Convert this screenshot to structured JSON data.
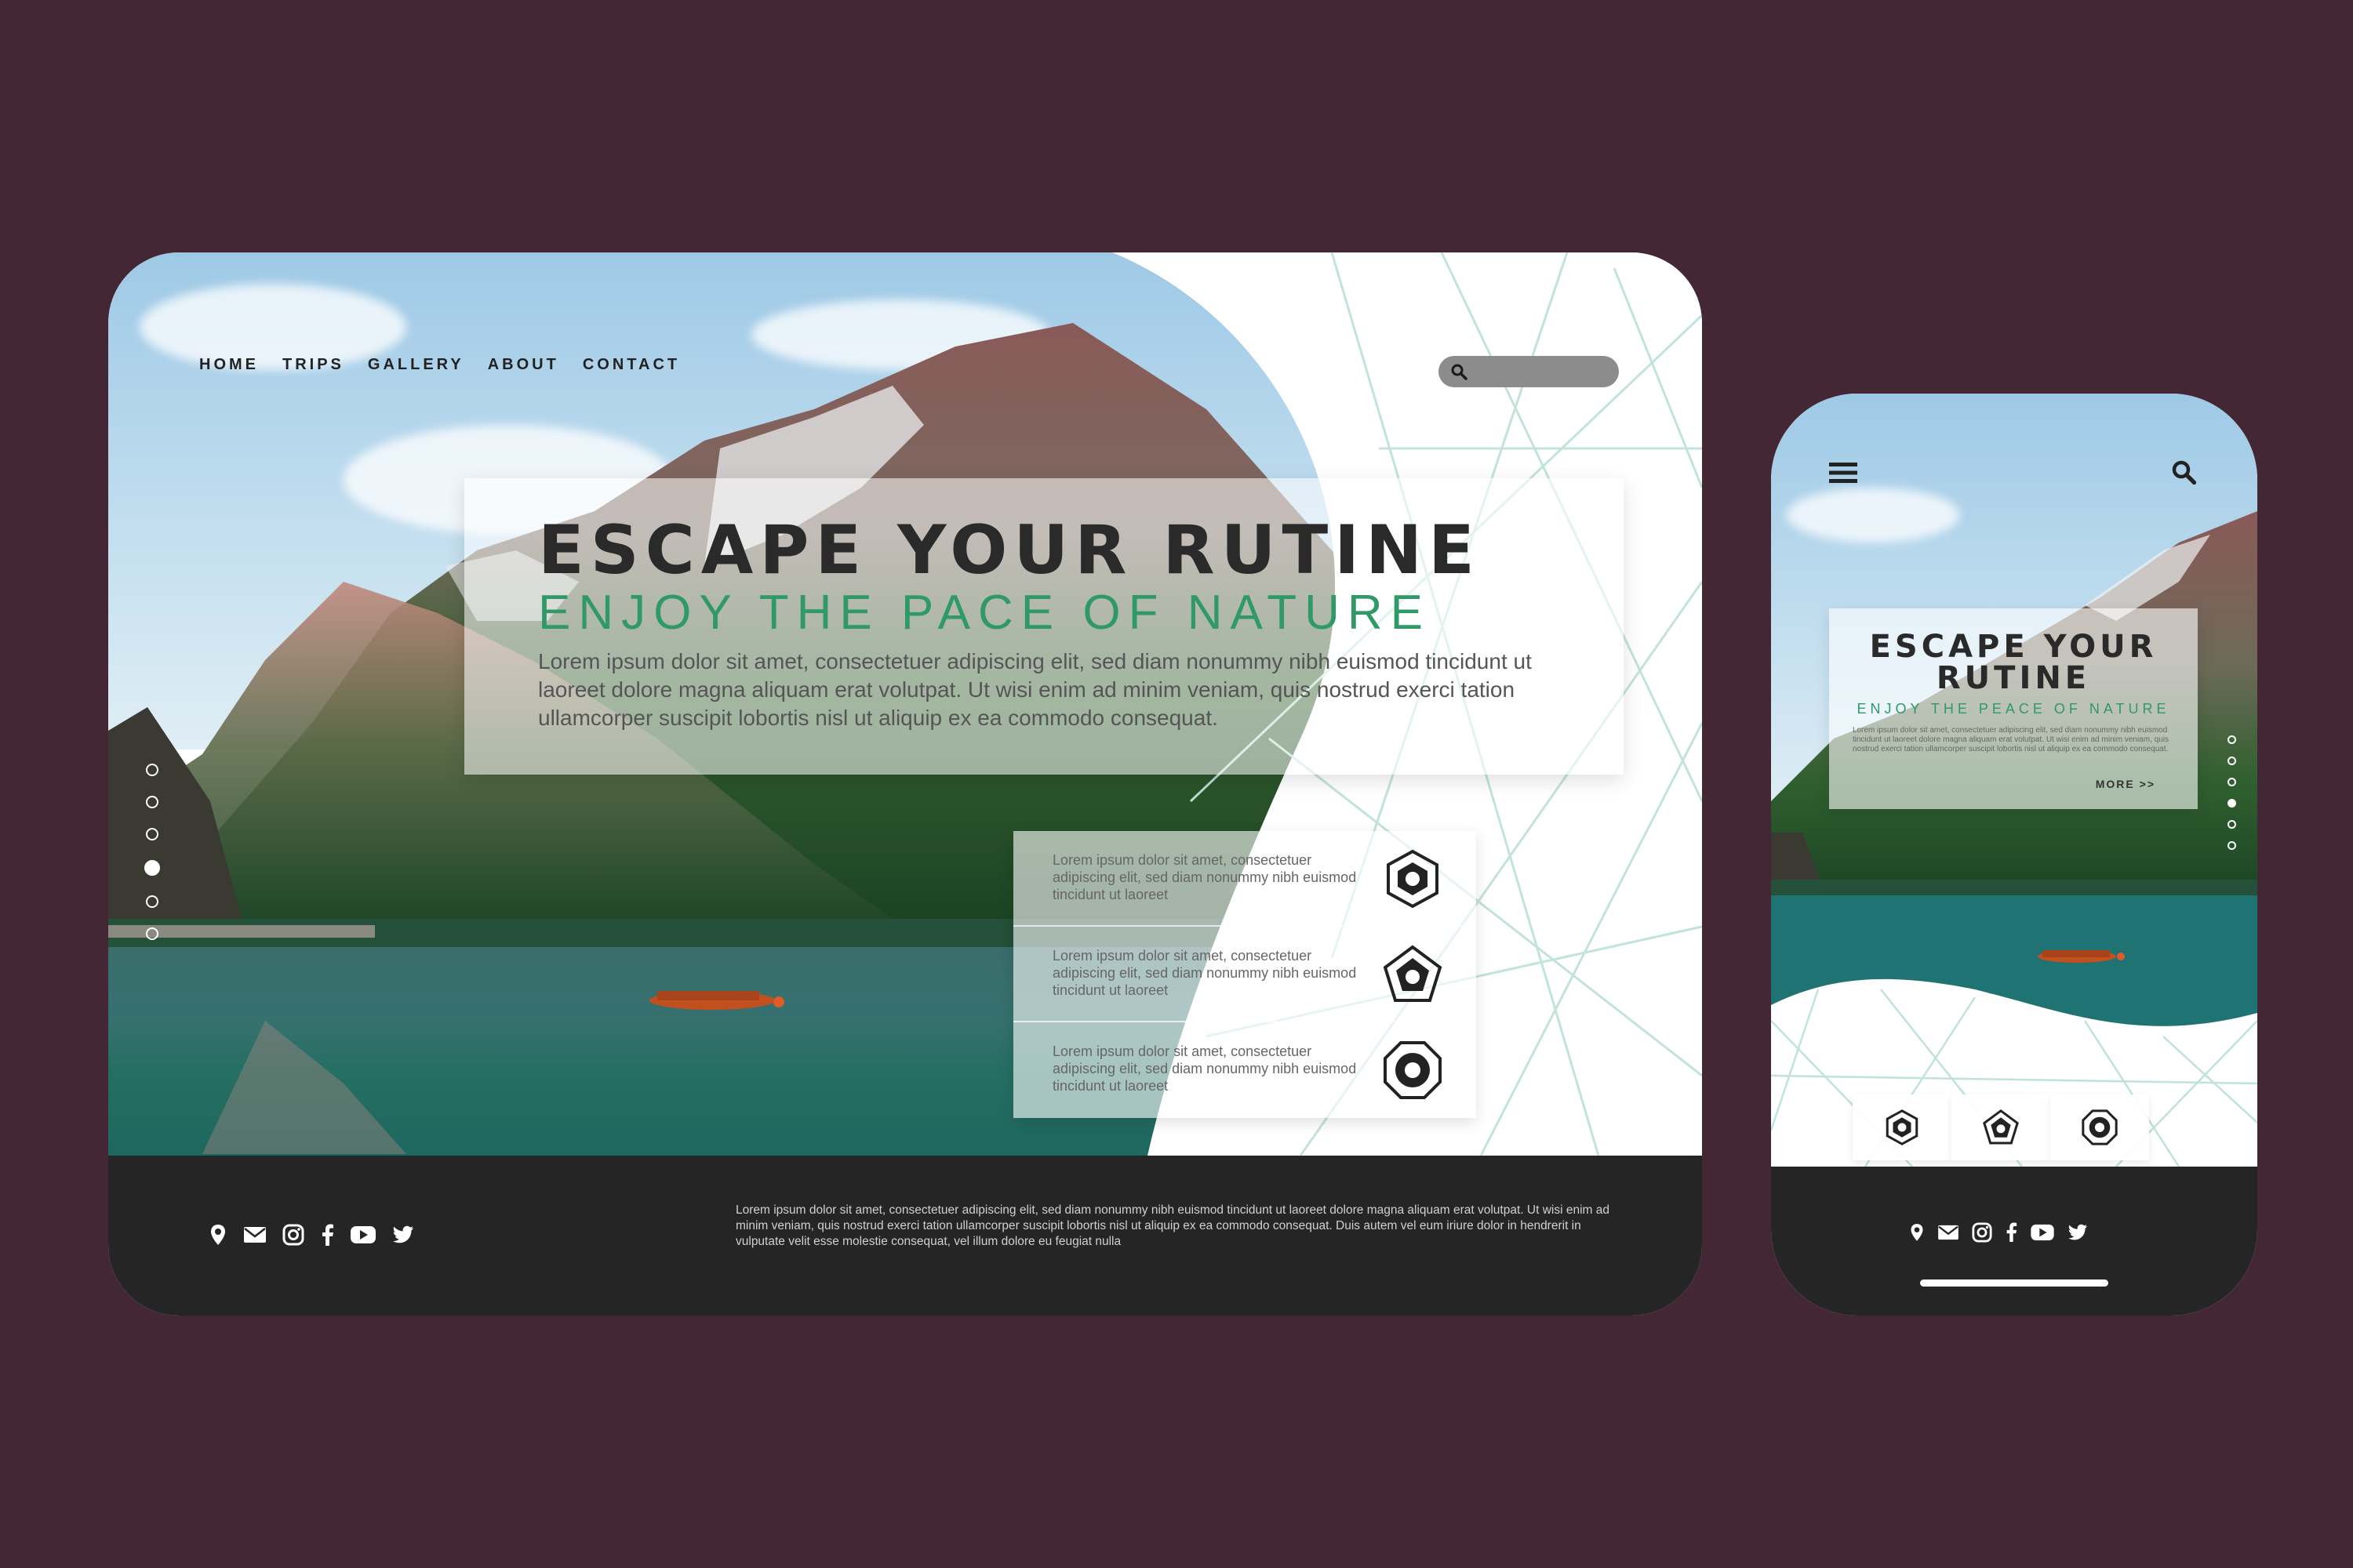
{
  "colors": {
    "background": "#442735",
    "footer": "#252525",
    "title": "#2a2a2a",
    "accent_green": "#2f9a67",
    "line_pattern": "#bfe3d6"
  },
  "desktop": {
    "nav": [
      "HOME",
      "TRIPS",
      "GALLERY",
      "ABOUT",
      "CONTACT"
    ],
    "search": {
      "icon": "search-icon",
      "placeholder": ""
    },
    "hero": {
      "title": "ESCAPE YOUR RUTINE",
      "subtitle": "ENJOY THE PACE OF NATURE",
      "body": "Lorem ipsum dolor sit amet, consectetuer adipiscing elit, sed diam nonummy nibh euismod tincidunt ut laoreet dolore magna aliquam erat volutpat. Ut wisi enim ad minim veniam, quis nostrud exerci tation ullamcorper suscipit lobortis nisl ut aliquip ex ea commodo consequat."
    },
    "features": [
      {
        "text": "Lorem ipsum dolor sit amet, consectetuer adipiscing elit, sed diam nonummy nibh euismod tincidunt ut laoreet",
        "icon": "hexagon-nut-icon"
      },
      {
        "text": "Lorem ipsum dolor sit amet, consectetuer adipiscing elit, sed diam nonummy nibh euismod tincidunt ut laoreet",
        "icon": "pentagon-nut-icon"
      },
      {
        "text": "Lorem ipsum dolor sit amet, consectetuer adipiscing elit, sed diam nonummy nibh euismod tincidunt ut laoreet",
        "icon": "octagon-nut-icon"
      }
    ],
    "slider": {
      "count": 6,
      "active_index": 3
    },
    "footer": {
      "social_icons": [
        "location-pin-icon",
        "email-icon",
        "instagram-icon",
        "facebook-icon",
        "youtube-icon",
        "twitter-icon"
      ],
      "text": "Lorem ipsum dolor sit amet, consectetuer adipiscing elit, sed diam nonummy nibh euismod tincidunt ut laoreet dolore magna aliquam erat volutpat. Ut wisi enim ad minim veniam, quis nostrud exerci tation ullamcorper suscipit lobortis nisl ut aliquip ex ea commodo consequat. Duis autem vel eum iriure dolor in hendrerit in vulputate velit esse molestie consequat, vel illum dolore eu feugiat nulla"
    }
  },
  "mobile": {
    "menu_icon": "hamburger-menu-icon",
    "search_icon": "search-icon",
    "hero": {
      "title_line1": "ESCAPE YOUR",
      "title_line2": "RUTINE",
      "subtitle": "ENJOY THE PEACE OF NATURE",
      "body": "Lorem ipsum dolor sit amet, consectetuer adipiscing elit, sed diam nonummy nibh euismod tincidunt ut laoreet dolore magna aliquam erat volutpat. Ut wisi enim ad minim veniam, quis nostrud exerci tation ullamcorper suscipit lobortis nisl ut aliquip ex ea commodo consequat.",
      "more": "MORE >>"
    },
    "slider": {
      "count": 6,
      "active_index": 3
    },
    "feature_icons": [
      "hexagon-nut-icon",
      "pentagon-nut-icon",
      "octagon-nut-icon"
    ],
    "social_icons": [
      "location-pin-icon",
      "email-icon",
      "instagram-icon",
      "facebook-icon",
      "youtube-icon",
      "twitter-icon"
    ]
  }
}
